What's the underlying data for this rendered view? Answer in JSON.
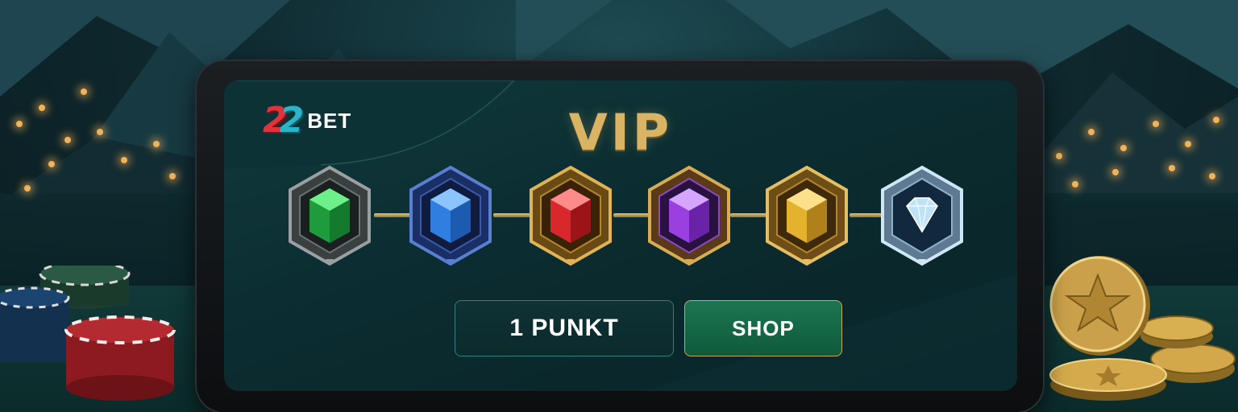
{
  "brand": {
    "logo_number": "22",
    "logo_text": "BET"
  },
  "vip": {
    "title": "VIP",
    "tiers": [
      {
        "gem": "green-gem-icon",
        "color": "#2fbf4a",
        "frame": "silver"
      },
      {
        "gem": "blue-gem-icon",
        "color": "#2f86e0",
        "frame": "blue"
      },
      {
        "gem": "red-gem-icon",
        "color": "#d8282e",
        "frame": "gold"
      },
      {
        "gem": "purple-gem-icon",
        "color": "#9a3fe0",
        "frame": "gold"
      },
      {
        "gem": "gold-gem-icon",
        "color": "#e5b22e",
        "frame": "gold"
      },
      {
        "gem": "diamond-icon",
        "color": "#bfe3f5",
        "frame": "platinum"
      }
    ]
  },
  "buttons": {
    "points_label": "1 PUNKT",
    "shop_label": "SHOP"
  },
  "colors": {
    "accent_gold": "#d9b464",
    "shop_green": "#1c7650",
    "logo_red": "#e0333c",
    "logo_teal": "#2bb3c8"
  }
}
